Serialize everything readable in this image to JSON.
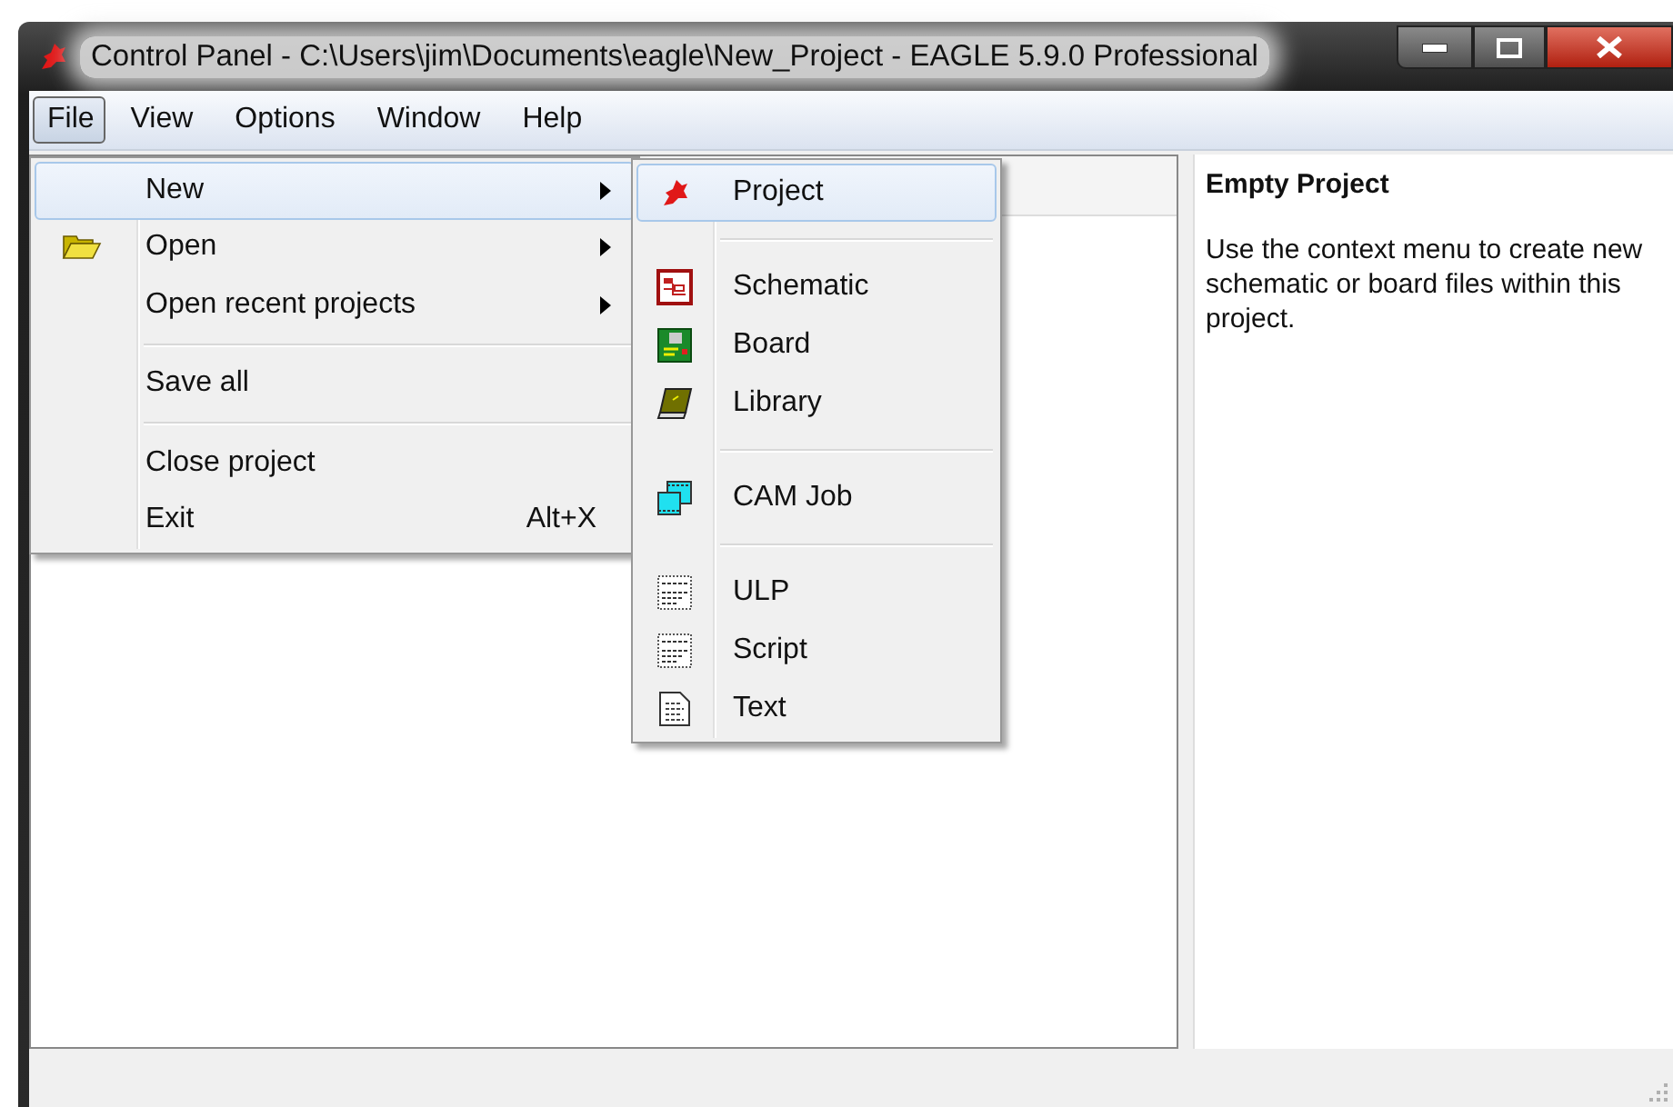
{
  "window": {
    "title": "Control Panel - C:\\Users\\jim\\Documents\\eagle\\New_Project - EAGLE 5.9.0 Professional"
  },
  "menu_bar": [
    {
      "label": "File",
      "selected": true
    },
    {
      "label": "View",
      "selected": false
    },
    {
      "label": "Options",
      "selected": false
    },
    {
      "label": "Window",
      "selected": false
    },
    {
      "label": "Help",
      "selected": false
    }
  ],
  "file_menu": {
    "items": [
      {
        "kind": "item",
        "label": "New",
        "submenu": true,
        "selected": true
      },
      {
        "kind": "item",
        "label": "Open",
        "submenu": true,
        "selected": false
      },
      {
        "kind": "item",
        "label": "Open recent projects",
        "submenu": true,
        "selected": false
      },
      {
        "kind": "separator"
      },
      {
        "kind": "item",
        "label": "Save all",
        "submenu": false,
        "selected": false
      },
      {
        "kind": "separator"
      },
      {
        "kind": "item",
        "label": "Close project",
        "submenu": false,
        "selected": false
      },
      {
        "kind": "item",
        "label": "Exit",
        "shortcut": "Alt+X",
        "submenu": false,
        "selected": false
      }
    ]
  },
  "new_submenu": {
    "items": [
      {
        "kind": "item",
        "label": "Project",
        "selected": true
      },
      {
        "kind": "separator"
      },
      {
        "kind": "item",
        "label": "Schematic",
        "selected": false
      },
      {
        "kind": "item",
        "label": "Board",
        "selected": false
      },
      {
        "kind": "item",
        "label": "Library",
        "selected": false
      },
      {
        "kind": "separator"
      },
      {
        "kind": "item",
        "label": "CAM Job",
        "selected": false
      },
      {
        "kind": "separator"
      },
      {
        "kind": "item",
        "label": "ULP",
        "selected": false
      },
      {
        "kind": "item",
        "label": "Script",
        "selected": false
      },
      {
        "kind": "item",
        "label": "Text",
        "selected": false
      }
    ]
  },
  "info_panel": {
    "title": "Empty Project",
    "text": "Use the context menu to create new schematic or board files within this project."
  }
}
